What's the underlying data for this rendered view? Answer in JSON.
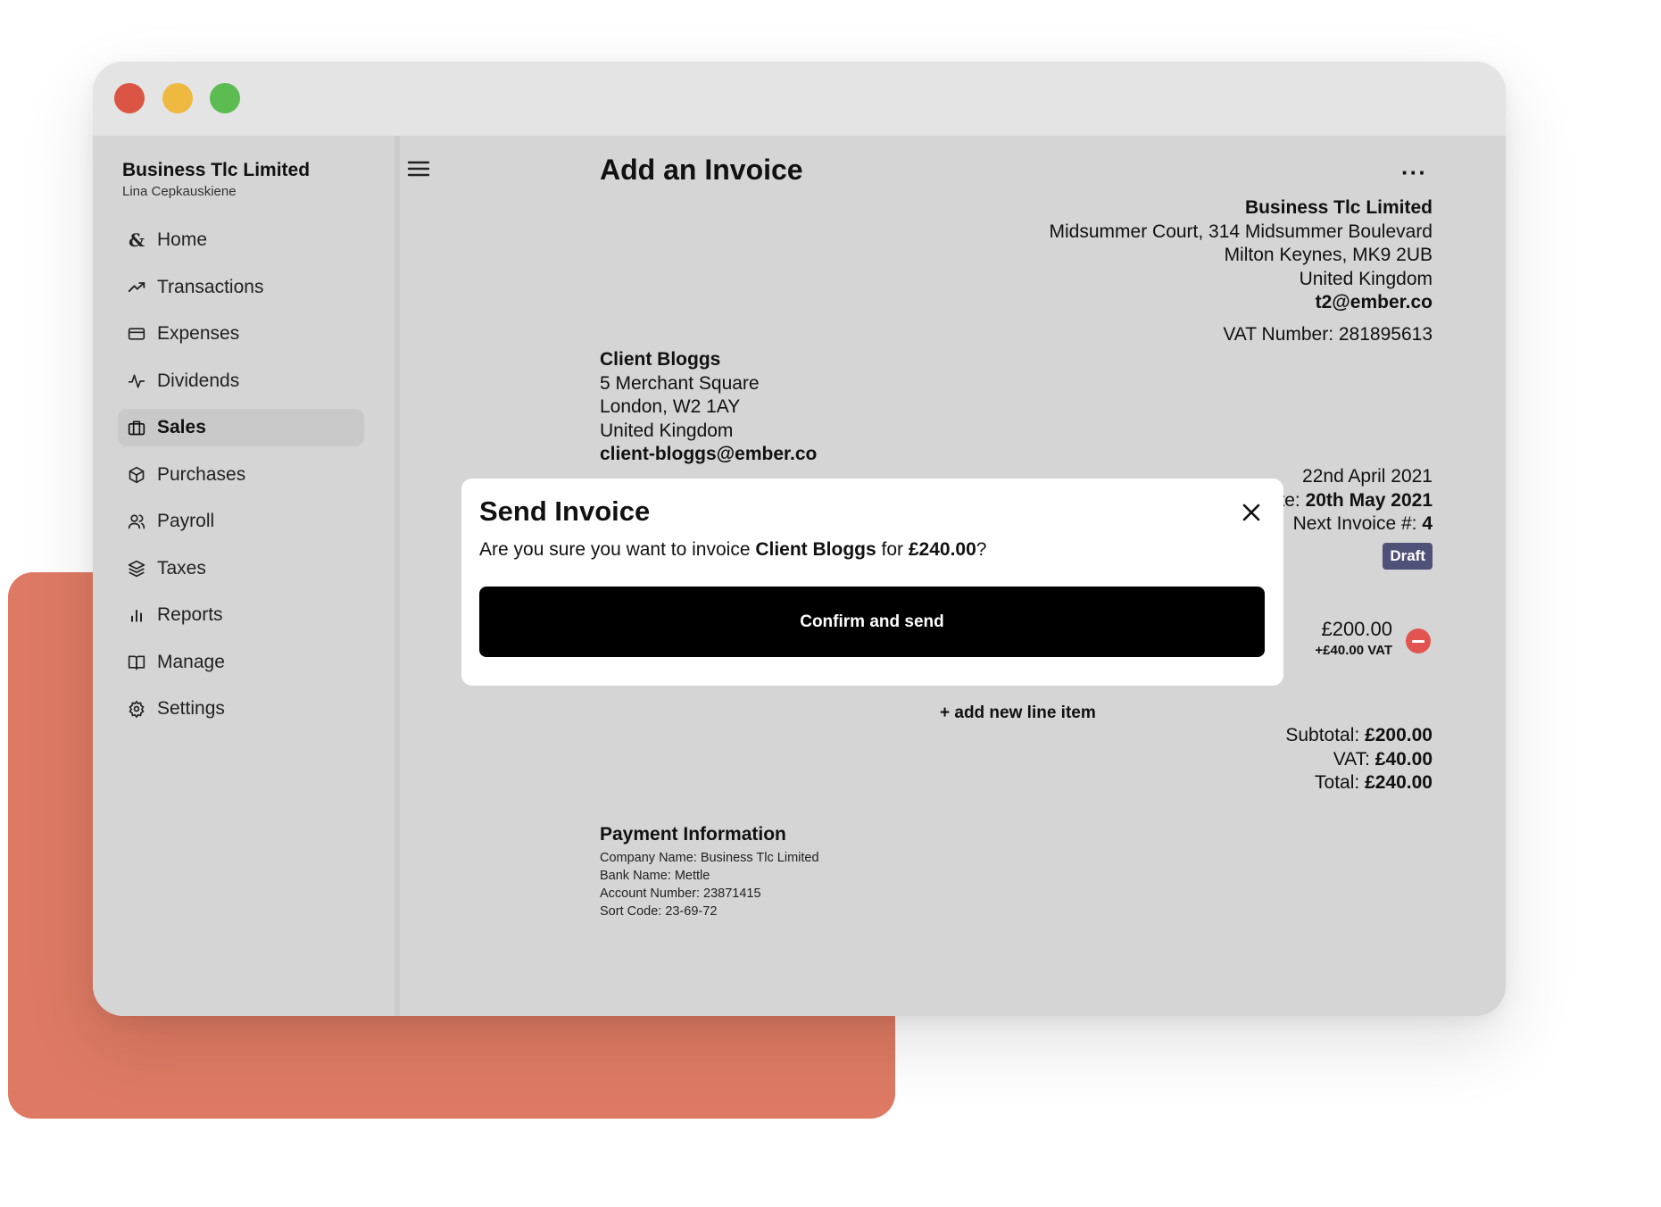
{
  "colors": {
    "accent_background": "#de7a63",
    "window_background": "#d5d5d5",
    "titlebar": "#e3e4e3",
    "draft_badge": "#4f5179",
    "remove_button": "#e2544f",
    "confirm_button": "#000000"
  },
  "sidebar": {
    "org_name": "Business Tlc Limited",
    "user_name": "Lina Cepkauskiene",
    "items": [
      {
        "label": "Home",
        "icon": "ampersand-icon"
      },
      {
        "label": "Transactions",
        "icon": "trend-up-icon"
      },
      {
        "label": "Expenses",
        "icon": "credit-card-icon"
      },
      {
        "label": "Dividends",
        "icon": "activity-icon"
      },
      {
        "label": "Sales",
        "icon": "briefcase-icon",
        "active": true
      },
      {
        "label": "Purchases",
        "icon": "box-icon"
      },
      {
        "label": "Payroll",
        "icon": "users-icon"
      },
      {
        "label": "Taxes",
        "icon": "layers-icon"
      },
      {
        "label": "Reports",
        "icon": "bar-chart-icon"
      },
      {
        "label": "Manage",
        "icon": "book-icon"
      },
      {
        "label": "Settings",
        "icon": "gear-icon"
      }
    ]
  },
  "header": {
    "title": "Add an Invoice",
    "more_label": "···"
  },
  "company": {
    "name": "Business Tlc Limited",
    "address_line1": "Midsummer Court, 314 Midsummer Boulevard",
    "address_line2": "Milton Keynes, MK9 2UB",
    "country": "United Kingdom",
    "email": "t2@ember.co",
    "vat_number": "VAT Number: 281895613"
  },
  "client": {
    "name": "Client Bloggs",
    "address_line1": "5 Merchant Square",
    "address_line2": "London, W2 1AY",
    "country": "United Kingdom",
    "email": "client-bloggs@ember.co"
  },
  "invoice_meta": {
    "date_value": "22nd April 2021",
    "due_label": "te: ",
    "due_value": "20th May 2021",
    "next_invoice_label": "Next Invoice #: ",
    "next_invoice_value": "4",
    "status": "Draft"
  },
  "line_item": {
    "amount": "£200.00",
    "vat": "+£40.00 VAT"
  },
  "add_line_label": "+ add new line item",
  "totals": {
    "subtotal_label": "Subtotal: ",
    "subtotal_value": "£200.00",
    "vat_label": "VAT: ",
    "vat_value": "£40.00",
    "total_label": "Total: ",
    "total_value": "£240.00"
  },
  "payment": {
    "heading": "Payment Information",
    "company_name": "Company Name: Business Tlc Limited",
    "bank_name": "Bank Name: Mettle",
    "account_number": "Account Number: 23871415",
    "sort_code": "Sort Code: 23-69-72"
  },
  "modal": {
    "title": "Send Invoice",
    "text_prefix": "Are you sure you want to invoice ",
    "client": "Client Bloggs",
    "text_mid": " for ",
    "amount": "£240.00",
    "text_suffix": "?",
    "confirm_label": "Confirm and send"
  }
}
